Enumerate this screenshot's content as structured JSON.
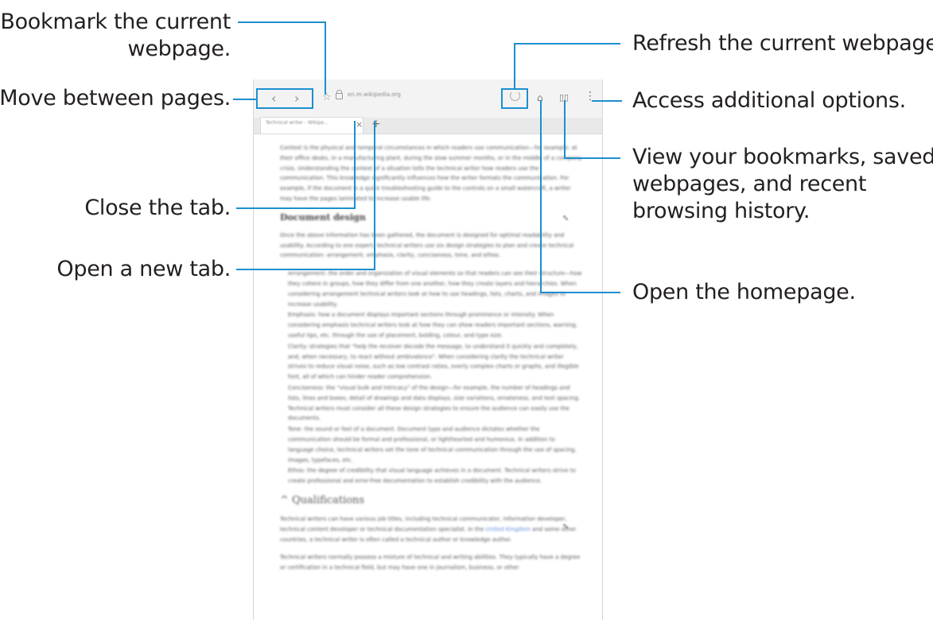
{
  "callouts": {
    "bookmark": "Bookmark the current\nwebpage.",
    "bookmark_l1": "Bookmark the current",
    "bookmark_l2": "webpage.",
    "move": "Move between pages.",
    "close_tab": "Close the tab.",
    "new_tab": "Open a new tab.",
    "refresh": "Refresh the current webpage.",
    "options": "Access additional options.",
    "bookmarks_view_l1": "View your bookmarks, saved",
    "bookmarks_view_l2": "webpages, and recent",
    "bookmarks_view_l3": "browsing history.",
    "homepage": "Open the homepage."
  },
  "browser": {
    "url": "en.m.wikipedia.org",
    "tab_title": "Technical writer - Wikipe...",
    "back_glyph": "‹",
    "forward_glyph": "›",
    "star_glyph": "☆",
    "tab_close_glyph": "×",
    "new_tab_glyph": "+",
    "home_glyph": "⌂",
    "bookmarks_glyph": "▯▯",
    "more_glyph": "⋮",
    "accent_color": "#1d8fcf"
  },
  "article": {
    "intro": "Context is the physical and temporal circumstances in which readers use communication—for example: at their office desks, in a manufacturing plant, during the slow summer months, or in the middle of a company crisis. Understanding the context of a situation tells the technical writer how readers use the communication. This knowledge significantly influences how the writer formats the communication. For example, if the document is a quick troubleshooting guide to the controls on a small watercraft, a writer may have the pages laminated to increase usable life.",
    "section1_heading": "Document design",
    "section1_intro": "Once the above information has been gathered, the document is designed for optimal readability and usability. According to one expert, technical writers use six design strategies to plan and create technical communication: arrangement, emphasis, clarity, conciseness, tone, and ethos.",
    "arrangement": "Arrangement: the order and organization of visual elements so that readers can see their structure—how they cohere in groups, how they differ from one another, how they create layers and hierarchies. When considering arrangement technical writers look at how to use headings, lists, charts, and images to increase usability.",
    "emphasis": "Emphasis: how a document displays important sections through prominence or intensity. When considering emphasis technical writers look at how they can show readers important sections, warning, useful tips, etc. through the use of placement, bolding, colour, and type size.",
    "clarity": "Clarity: strategies that \"help the receiver decode the message, to understand it quickly and completely, and, when necessary, to react without ambivalence\". When considering clarity the technical writer strives to reduce visual noise, such as low contrast ratios, overly complex charts or graphs, and illegible font, all of which can hinder reader comprehension.",
    "conciseness": "Conciseness: the \"visual bulk and intricacy\" of the design—for example, the number of headings and lists, lines and boxes, detail of drawings and data displays, size variations, ornateness, and text spacing. Technical writers must consider all these design strategies to ensure the audience can easily use the documents.",
    "tone": "Tone: the sound or feel of a document. Document type and audience dictates whether the communication should be formal and professional, or lighthearted and humorous. In addition to language choice, technical writers set the tone of technical communication through the use of spacing, images, typefaces, etc.",
    "ethos": "Ethos: the degree of credibility that visual language achieves in a document. Technical writers strive to create professional and error-free documentation to establish credibility with the audience.",
    "section2_heading": "^ Qualifications",
    "qual_1_pre": "Technical writers can have various job titles, including technical communicator, information developer, technical content developer or technical documentation specialist. In the ",
    "qual_1_link": "United Kingdom",
    "qual_1_post": " and some other countries, a technical writer is often called a technical author or knowledge author.",
    "qual_2": "Technical writers normally possess a mixture of technical and writing abilities. They typically have a degree or certification in a technical field, but may have one in journalism, business, or other"
  }
}
